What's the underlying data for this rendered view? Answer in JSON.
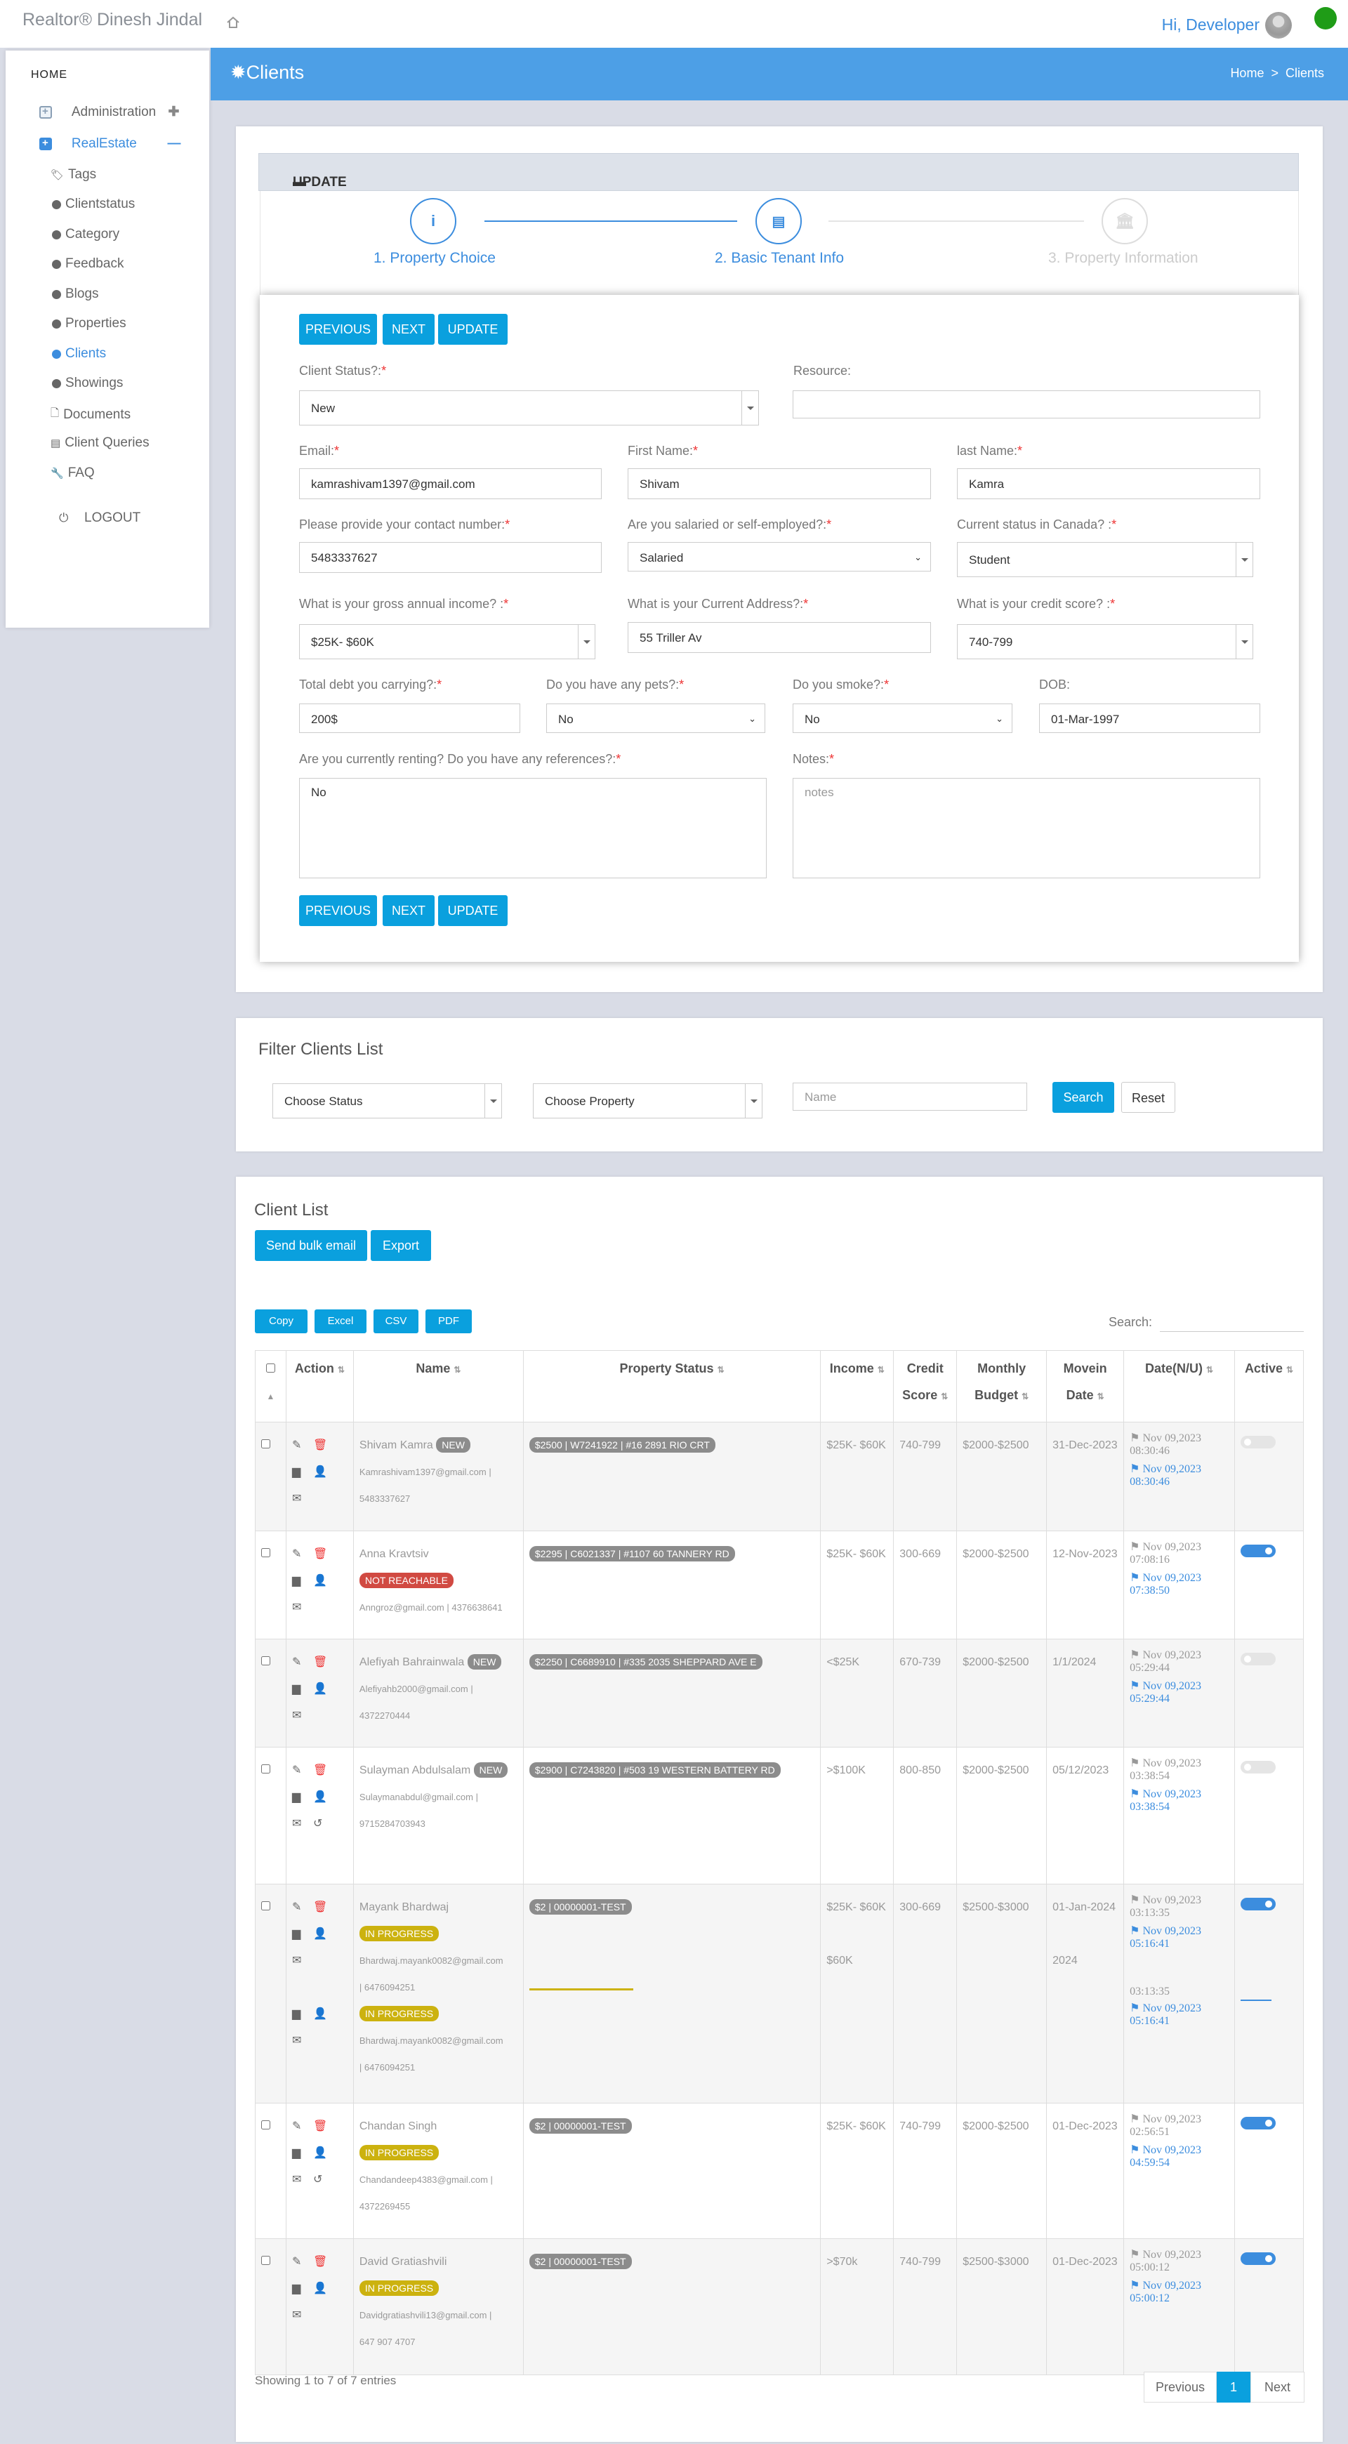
{
  "header": {
    "brand": "Realtor® Dinesh Jindal",
    "greeting": "Hi, Developer"
  },
  "sidebar": {
    "home": "HOME",
    "items": [
      "Administration",
      "RealEstate",
      "Tags",
      "Clientstatus",
      "Category",
      "Feedback",
      "Blogs",
      "Properties",
      "Clients",
      "Showings",
      "Documents",
      "Client Queries",
      "FAQ"
    ],
    "logout": "LOGOUT"
  },
  "page": {
    "title": "Clients",
    "crumb_home": "Home",
    "crumb_current": "Clients"
  },
  "update": {
    "title": "UPDATE",
    "steps": [
      "1. Property Choice",
      "2. Basic Tenant Info",
      "3. Property Information"
    ],
    "buttons": {
      "prev": "PREVIOUS",
      "next": "NEXT",
      "update": "UPDATE"
    },
    "fields": {
      "status_label": "Client Status?:",
      "status_value": "New",
      "resource_label": "Resource:",
      "email_label": "Email:",
      "email_value": "kamrashivam1397@gmail.com",
      "first_label": "First Name:",
      "first_value": "Shivam",
      "last_label": "last Name:",
      "last_value": "Kamra",
      "contact_label": "Please provide your contact number:",
      "contact_value": "5483337627",
      "salaried_label": "Are you salaried or self-employed?:",
      "salaried_value": "Salaried",
      "canada_label": "Current status in Canada? :",
      "canada_value": "Student",
      "income_label": "What is your gross annual income? :",
      "income_value": "$25K- $60K",
      "address_label": "What is your Current Address?:",
      "address_value": "55 Triller Av",
      "credit_label": "What is your credit score? :",
      "credit_value": "740-799",
      "debt_label": "Total debt you carrying?:",
      "debt_value": "200$",
      "pets_label": "Do you have any pets?:",
      "pets_value": "No",
      "smoke_label": "Do you smoke?:",
      "smoke_value": "No",
      "dob_label": "DOB:",
      "dob_value": "01-Mar-1997",
      "renting_label": "Are you currently renting? Do you have any references?:",
      "renting_value": "No",
      "notes_label": "Notes:",
      "notes_placeholder": "notes"
    }
  },
  "filter": {
    "title": "Filter Clients List",
    "status": "Choose Status",
    "property": "Choose Property",
    "name_placeholder": "Name",
    "search": "Search",
    "reset": "Reset"
  },
  "list": {
    "title": "Client List",
    "bulk": "Send bulk email",
    "export": "Export",
    "copy": "Copy",
    "excel": "Excel",
    "csv": "CSV",
    "pdf": "PDF",
    "search_label": "Search:",
    "headers": {
      "action": "Action",
      "name": "Name",
      "prop": "Property Status",
      "income": "Income",
      "credit": "Credit Score",
      "budget": "Monthly Budget",
      "movein": "Movein Date",
      "date": "Date(N/U)",
      "active": "Active"
    },
    "rows": [
      {
        "name": "Shivam Kamra",
        "badge": "NEW",
        "email": "Kamrashivam1397@gmail.com |",
        "phone": "5483337627",
        "prop": "$2500 | W7241922 | #16 2891 RIO CRT",
        "income": "$25K- $60K",
        "credit": "740-799",
        "budget": "$2000-$2500",
        "movein": "31-Dec-2023",
        "date_n": "Nov 09,2023 08:30:46",
        "date_u": "Nov 09,2023 08:30:46",
        "active": false
      },
      {
        "name": "Anna Kravtsiv",
        "badge": "NOT REACHABLE",
        "email": "Anngroz@gmail.com | 4376638641",
        "phone": "",
        "prop": "$2295 | C6021337 | #1107 60 TANNERY RD",
        "income": "$25K- $60K",
        "credit": "300-669",
        "budget": "$2000-$2500",
        "movein": "12-Nov-2023",
        "date_n": "Nov 09,2023 07:08:16",
        "date_u": "Nov 09,2023 07:38:50",
        "active": true
      },
      {
        "name": "Alefiyah Bahrainwala",
        "badge": "NEW",
        "email": "Alefiyahb2000@gmail.com |",
        "phone": "4372270444",
        "prop": "$2250 | C6689910 | #335 2035 SHEPPARD AVE E",
        "income": "<$25K",
        "credit": "670-739",
        "budget": "$2000-$2500",
        "movein": "1/1/2024",
        "date_n": "Nov 09,2023 05:29:44",
        "date_u": "Nov 09,2023 05:29:44",
        "active": false
      },
      {
        "name": "Sulayman Abdulsalam",
        "badge": "NEW",
        "email": "Sulaymanabdul@gmail.com |",
        "phone": "9715284703943",
        "prop": "$2900 | C7243820 | #503 19 WESTERN BATTERY RD",
        "income": ">$100K",
        "credit": "800-850",
        "budget": "$2000-$2500",
        "movein": "05/12/2023",
        "date_n": "Nov 09,2023 03:38:54",
        "date_u": "Nov 09,2023 03:38:54",
        "active": false
      },
      {
        "name": "Mayank Bhardwaj",
        "badge": "IN PROGRESS",
        "email": "Bhardwaj.mayank0082@gmail.com",
        "phone": "| 6476094251",
        "prop": "$2 | 00000001-TEST",
        "income": "$25K- $60K",
        "credit": "300-669",
        "budget": "$2500-$3000",
        "movein": "01-Jan-2024",
        "date_n": "Nov 09,2023 03:13:35",
        "date_u": "Nov 09,2023 05:16:41",
        "active": true,
        "dup_badge": "IN PROGRESS",
        "dup_email": "Bhardwaj.mayank0082@gmail.com",
        "dup_phone": "| 6476094251",
        "dup_income": "$60K",
        "dup_movein": "2024",
        "dup_date_n": "03:13:35",
        "dup_date_u": "Nov 09,2023 05:16:41"
      },
      {
        "name": "Chandan Singh",
        "badge": "IN PROGRESS",
        "email": "Chandandeep4383@gmail.com |",
        "phone": "4372269455",
        "prop": "$2 | 00000001-TEST",
        "income": "$25K- $60K",
        "credit": "740-799",
        "budget": "$2000-$2500",
        "movein": "01-Dec-2023",
        "date_n": "Nov 09,2023 02:56:51",
        "date_u": "Nov 09,2023 04:59:54",
        "active": true
      },
      {
        "name": "David Gratiashvili",
        "badge": "IN PROGRESS",
        "email": "Davidgratiashvili13@gmail.com |",
        "phone": "647 907 4707",
        "prop": "$2 | 00000001-TEST",
        "income": ">$70k",
        "credit": "740-799",
        "budget": "$2500-$3000",
        "movein": "01-Dec-2023",
        "date_n": "Nov 09,2023 05:00:12",
        "date_u": "Nov 09,2023 05:00:12",
        "active": true
      }
    ],
    "showing": "Showing 1 to 7 of 7 entries",
    "prev": "Previous",
    "page": "1",
    "next": "Next"
  },
  "colors": {
    "accent": "#0aa0de",
    "header_blue": "#4d9fe6",
    "badge_new": "#8c8c8c",
    "badge_nr": "#d14a42",
    "badge_ip": "#ccb20f"
  }
}
